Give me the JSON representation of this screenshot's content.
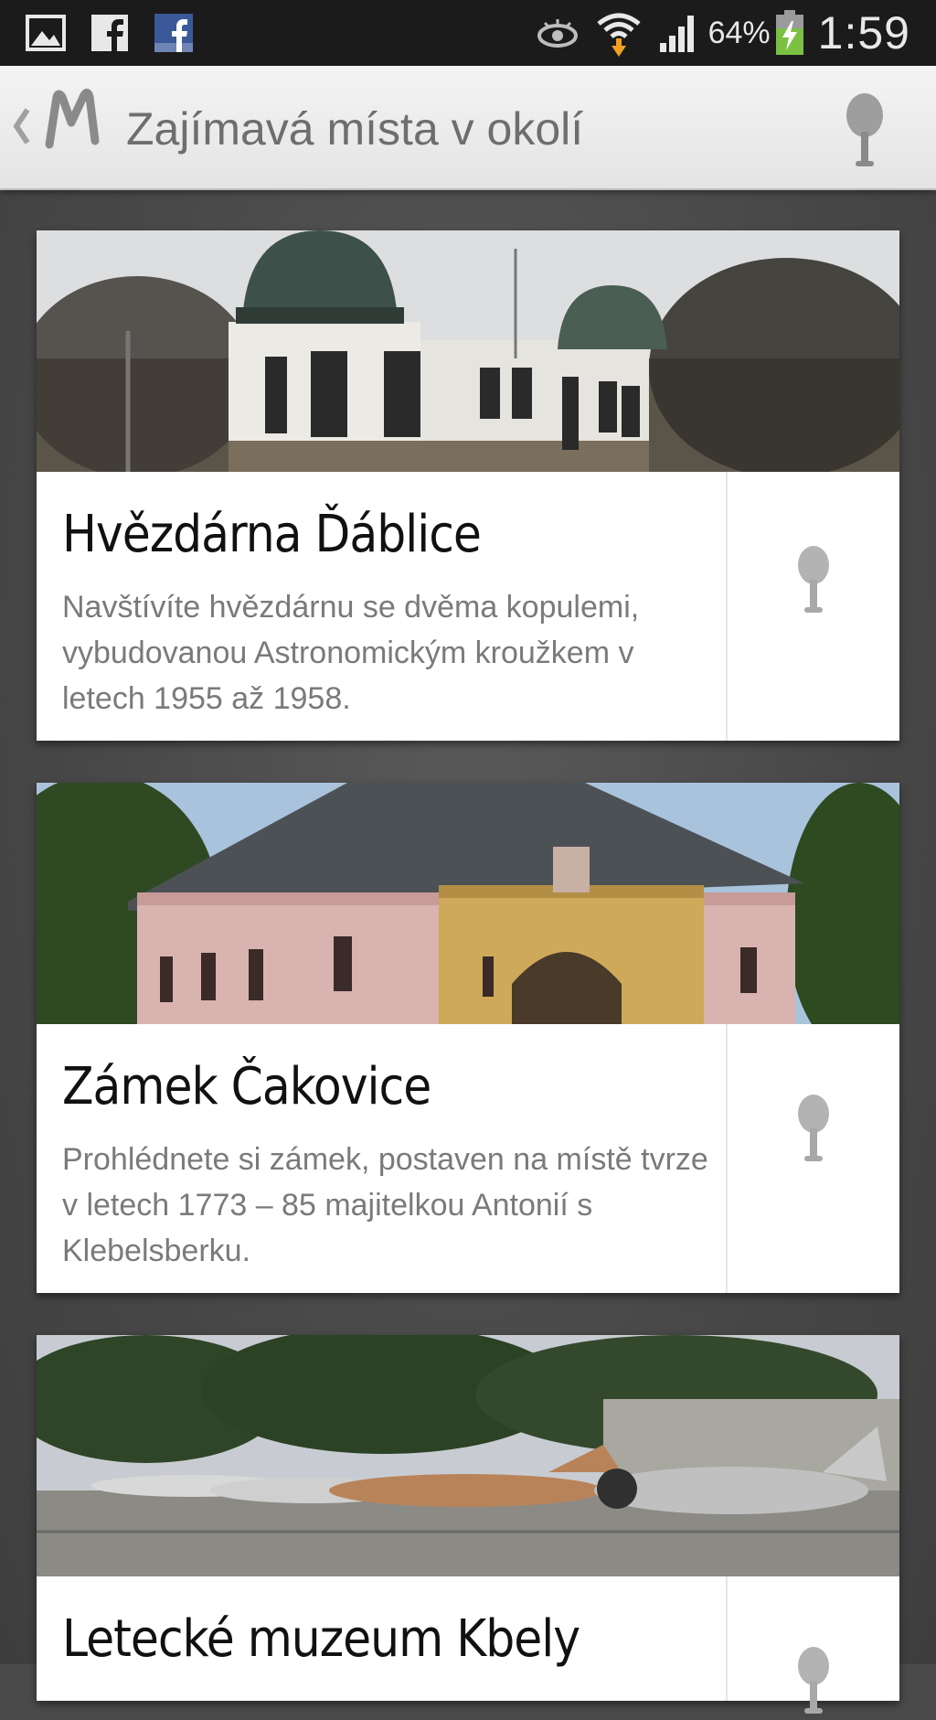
{
  "status_bar": {
    "battery_percent": "64%",
    "time": "1:59",
    "icons": [
      "gallery-icon",
      "facebook-icon",
      "facebook-blue-icon",
      "eye-icon",
      "wifi-download-icon",
      "signal-icon",
      "battery-charging-icon"
    ]
  },
  "action_bar": {
    "back_icon": "chevron-left-icon",
    "logo_icon": "m-logo-icon",
    "title": "Zajímavá místa v okolí",
    "map_pin_icon": "map-pin-icon"
  },
  "places": [
    {
      "title": "Hvězdárna Ďáblice",
      "description": "Navštívíte hvězdárnu se dvěma kopulemi, vybudovanou Astronomickým kroužkem v letech 1955 až 1958."
    },
    {
      "title": "Zámek Čakovice",
      "description": "Prohlédnete si zámek, postaven na místě tvrze v letech 1773 – 85 majitelkou Antonií s Klebelsberku."
    },
    {
      "title": "Letecké muzeum Kbely",
      "description": ""
    }
  ],
  "colors": {
    "status_bar": "#1b1b1b",
    "action_bar": "#eeeeee",
    "background": "#4a4a4a",
    "card": "#ffffff",
    "title_text": "#111111",
    "desc_text": "#7a7a7a"
  }
}
